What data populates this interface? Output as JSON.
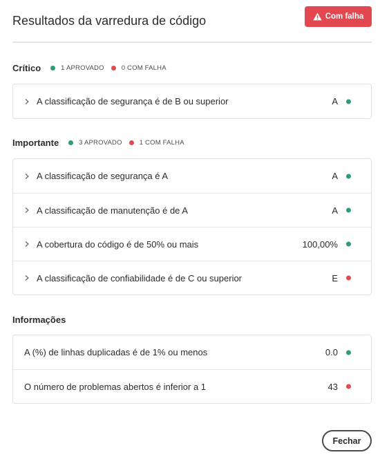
{
  "header": {
    "title": "Resultados da varredura de código",
    "status_badge": "Com falha",
    "status_icon": "warning-icon"
  },
  "colors": {
    "pass": "#2d9d78",
    "fail": "#e34850",
    "badge_bg": "#e34850"
  },
  "sections": [
    {
      "title": "Crítico",
      "passed": "1 APROVADO",
      "failed": "0 COM FALHA",
      "rows": [
        {
          "label": "A classificação de segurança é de B ou superior",
          "value": "A",
          "status": "pass"
        }
      ]
    },
    {
      "title": "Importante",
      "passed": "3 APROVADO",
      "failed": "1 COM FALHA",
      "rows": [
        {
          "label": "A classificação de segurança é A",
          "value": "A",
          "status": "pass"
        },
        {
          "label": "A classificação de manutenção é de A",
          "value": "A",
          "status": "pass"
        },
        {
          "label": "A cobertura do código é de 50% ou mais",
          "value": "100,00%",
          "status": "pass"
        },
        {
          "label": "A classificação de confiabilidade é de C ou superior",
          "value": "E",
          "status": "fail"
        }
      ]
    },
    {
      "title": "Informações",
      "rows": [
        {
          "label": "A (%) de linhas duplicadas é de 1% ou menos",
          "value": "0.0",
          "status": "pass"
        },
        {
          "label": "O número de problemas abertos é inferior a 1",
          "value": "43",
          "status": "fail"
        }
      ]
    }
  ],
  "footer": {
    "close_label": "Fechar"
  }
}
